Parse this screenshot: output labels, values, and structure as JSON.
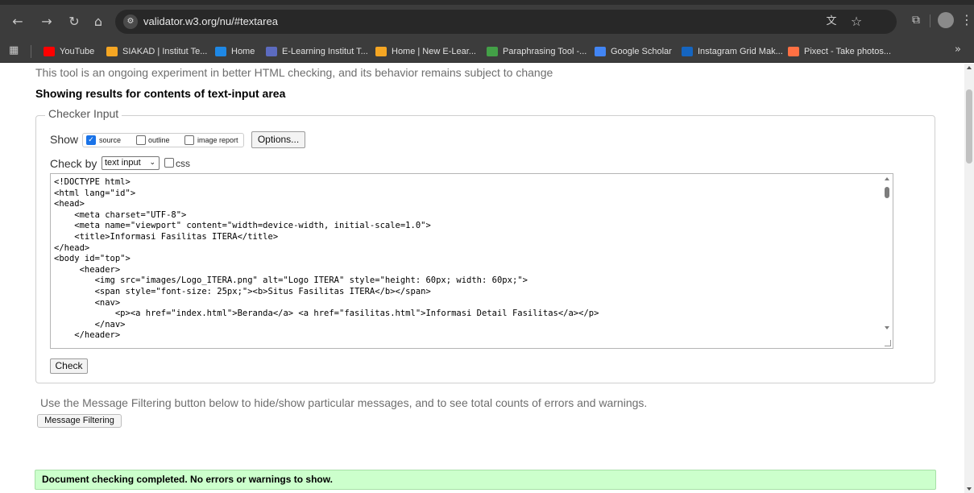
{
  "browser": {
    "url": "validator.w3.org/nu/#textarea",
    "icons": {
      "back": "arrow-left-icon",
      "forward": "arrow-right-icon",
      "reload": "reload-icon",
      "home": "home-icon",
      "site_info": "site-settings-icon",
      "translate": "translate-icon",
      "bookmark": "star-icon",
      "extensions": "extensions-icon",
      "menu": "kebab-menu-icon"
    },
    "bookmarks": [
      {
        "label": "YouTube",
        "color": "#ff0000"
      },
      {
        "label": "SIAKAD | Institut Te...",
        "color": "#f5a623"
      },
      {
        "label": "Home",
        "color": "#1e88e5"
      },
      {
        "label": "E-Learning Institut T...",
        "color": "#5c6bc0"
      },
      {
        "label": "Home | New E-Lear...",
        "color": "#f5a623"
      },
      {
        "label": "Paraphrasing Tool -...",
        "color": "#43a047"
      },
      {
        "label": "Google Scholar",
        "color": "#4285f4"
      },
      {
        "label": "Instagram Grid Mak...",
        "color": "#1565c0"
      },
      {
        "label": "Pixect - Take photos...",
        "color": "#ff7043"
      }
    ]
  },
  "page": {
    "intro": "This tool is an ongoing experiment in better HTML checking, and its behavior remains subject to change",
    "heading": "Showing results for contents of text-input area",
    "checker": {
      "legend": "Checker Input",
      "show_label": "Show",
      "show_options": [
        {
          "label": "source",
          "checked": true
        },
        {
          "label": "outline",
          "checked": false
        },
        {
          "label": "image report",
          "checked": false
        }
      ],
      "options_button": "Options...",
      "check_by_label": "Check by",
      "check_by_value": "text input",
      "css_label": "css",
      "code": "<!DOCTYPE html>\n<html lang=\"id\">\n<head>\n    <meta charset=\"UTF-8\">\n    <meta name=\"viewport\" content=\"width=device-width, initial-scale=1.0\">\n    <title>Informasi Fasilitas ITERA</title>\n</head>\n<body id=\"top\">\n     <header>\n        <img src=\"images/Logo_ITERA.png\" alt=\"Logo ITERA\" style=\"height: 60px; width: 60px;\">\n        <span style=\"font-size: 25px;\"><b>Situs Fasilitas ITERA</b></span>\n        <nav>\n            <p><a href=\"index.html\">Beranda</a> <a href=\"fasilitas.html\">Informasi Detail Fasilitas</a></p>\n        </nav>\n    </header>",
      "check_button": "Check"
    },
    "filter_text": "Use the Message Filtering button below to hide/show particular messages, and to see total counts of errors and warnings.",
    "filter_button": "Message Filtering",
    "result_message": "Document checking completed. No errors or warnings to show."
  }
}
